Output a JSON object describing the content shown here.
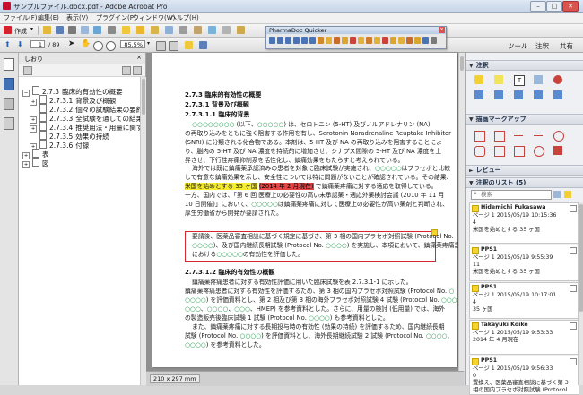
{
  "window": {
    "title": "サンプルファイル.docx.pdf - Adobe Acrobat Pro",
    "buttons": [
      "–",
      "□",
      "✕"
    ]
  },
  "menu": [
    "ファイル(F)",
    "編集(E)",
    "表示(V)",
    "プラグイン(P)",
    "ウィンドウ(W)",
    "ヘルプ(H)"
  ],
  "toolbar": {
    "create_label": "作成",
    "page_current": "1",
    "page_total": "/ 89",
    "zoom": "85.5%",
    "tools_label": "ツール",
    "sign_label": "注釈",
    "share_label": "共有"
  },
  "pharmadoc": {
    "title": "PharmaDoc Quicker"
  },
  "bookmarks": {
    "panel_title": "しおり",
    "items": [
      {
        "num": "2.7.3",
        "label": "臨床的有効性の概要",
        "toggle": "−",
        "level": 0
      },
      {
        "num": "2.7.3.1",
        "label": "背景及び概観",
        "toggle": "+",
        "level": 1
      },
      {
        "num": "2.7.3.2",
        "label": "個々の試験結果の要約",
        "toggle": "",
        "level": 1
      },
      {
        "num": "2.7.3.3",
        "label": "全試験を通しての結果の比",
        "toggle": "+",
        "level": 1
      },
      {
        "num": "2.7.3.4",
        "label": "推奨用法・用量に関する臨",
        "toggle": "+",
        "level": 1
      },
      {
        "num": "2.7.3.5",
        "label": "効果の持続",
        "toggle": "",
        "level": 1
      },
      {
        "num": "2.7.3.6",
        "label": "付録",
        "toggle": "+",
        "level": 1
      },
      {
        "num": "",
        "label": "表",
        "toggle": "+",
        "level": 0
      },
      {
        "num": "",
        "label": "図",
        "toggle": "+",
        "level": 0
      }
    ]
  },
  "document": {
    "headings": [
      "2.7.3 臨床的有効性の概要",
      "2.7.3.1 背景及び概観",
      "2.7.3.1.1 臨床的背景"
    ],
    "para1": [
      "○○○○○○○○ (以下、○○○○○) は、セロトニン (5-HT) 及びノルアドレナリン (NA)",
      "の再取り込みをともに強く阻害する作用を有し、Serotonin Noradrenaline Reuptake Inhibitor",
      "(SNRI) に分類される化合物である。本剤は、5-HT 及び NA の再取り込みを阻害することによ",
      "り、脳内の 5-HT 及び NA 濃度を持続的に増加させ、シナプス間隙の 5-HT 及び NA 濃度を上",
      "昇させ、下行性疼痛抑制系を活性化し、鎮痛効果をもたらすと考えられている。"
    ],
    "para2a": "海外では既に鎮痛薬承認済みの患者を対象に臨床試験が実施され、○○○○○はプラセボと比較",
    "para2b": "して有意な鎮痛効果を示し、安全性については特に問題がないことが確認されている。その結果、",
    "para2c_pre": "",
    "para2c_yellow": "米国を始めとする 35 ヶ国",
    "para2c_red": "(2014 年 2 月現在)",
    "para2c_post": "で鎮痛薬疼痛に対する適応を取得している。",
    "para2d": "一方、国内では、「第 6 回 医療上の必要性の高い未承認薬・適応外薬検討会議 (2010 年 11 月",
    "para2e": "10 日開催)」において、○○○○○は鎮痛薬疼痛に対して医療上の必要性が高い薬剤と判断され、",
    "para2f": "厚生労働省から開発が要請された。",
    "box": [
      "要請後、医薬品審査相談に基づく規定に基づき、第 3 相の国内プラセボ対照試験 (Protocol No.",
      "○○○○)、及び国内継続長期試験 (Protocol No. ○○○○) を実施し、本項において、鎮痛薬疼痛患者",
      "における○○○○○の有効性を評価した。"
    ],
    "heading4": "2.7.3.1.2 臨床的有効性の概観",
    "para3": [
      "鎮痛薬疼痛患者に対する有効性評価に用いた臨床試験を表 2.7.3.1-1 に示した。",
      "鎮痛薬疼痛患者に対する有効性を評価するため、第 3 相の国内プラセボ対照試験 (Protocol No. ○",
      "○○○○) を評価資料とし、第 2 相及び第 3 相の海外プラセボ対照試験 4 試験 (Protocol No. ○○○",
      "○○○、○○○○、○○○、HMEP) を参考資料とした。さらに、用量の検討 (低用量) では、海外",
      "の製造販売後臨床試験 1 試験 (Protocol No. ○○○○) も参考資料とした。",
      "また、鎮痛薬疼痛に対する長期投与時の有効性 (効果の持続) を評価するため、国内継続長期",
      "試験 (Protocol No. ○○○○) を評価資料とし、海外長期継続試験 2 試験 (Protocol No. ○○○○、",
      "○○○○) を参考資料とした。"
    ],
    "page_size": "210 x 297 mm"
  },
  "rightpane": {
    "annotations_label": "注釈",
    "drawing_label": "描画マークアップ",
    "review_label": "レビュー",
    "comment_list_label": "注釈のリスト (5)",
    "search_placeholder": "検索",
    "comments": [
      {
        "author": "Hidemichi Fukasawa",
        "meta": "ページ 1  2015/05/19 10:15:36",
        "lines": [
          "4",
          "米国を始めとする 35 ヶ国"
        ]
      },
      {
        "author": "PPS1",
        "meta": "ページ 1  2015/05/19 9:55:39",
        "lines": [
          "11",
          "米国を始めとする 35 ヶ国"
        ]
      },
      {
        "author": "PPS1",
        "meta": "ページ 1  2015/05/19 10:17:01",
        "lines": [
          "4",
          "35 ヶ国"
        ]
      },
      {
        "author": "Takayuki Koike",
        "meta": "ページ 1  2015/05/19 9:53:33",
        "lines": [
          "2014 年 4 月現在",
          ""
        ]
      },
      {
        "author": "PPS1",
        "meta": "ページ 1  2015/05/19 9:56:33",
        "lines": [
          "0",
          "置換え、医薬品審査相談に基づく第 3",
          "相の国内プラセボ対照試験 (Protocol"
        ]
      }
    ]
  },
  "colors": {
    "highlight_yellow": "#f6ec2e",
    "highlight_red": "#e24646",
    "box_red": "#d7262e",
    "square_green": "#159440"
  }
}
